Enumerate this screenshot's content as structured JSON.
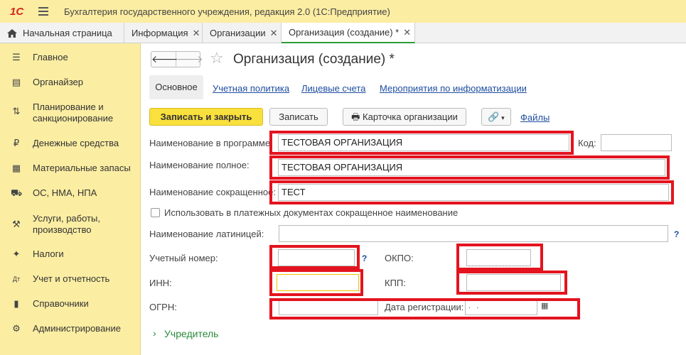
{
  "app": {
    "logo": "1С",
    "title": "Бухгалтерия государственного учреждения, редакция 2.0  (1С:Предприятие)"
  },
  "tabs": [
    {
      "label": "Начальная страница"
    },
    {
      "label": "Информация"
    },
    {
      "label": "Организации"
    },
    {
      "label": "Организация (создание) *"
    }
  ],
  "sidebar": {
    "items": [
      {
        "label": "Главное",
        "icon": "list-icon"
      },
      {
        "label": "Органайзер",
        "icon": "clipboard-icon"
      },
      {
        "label": "Планирование и",
        "label2": "санкционирование",
        "icon": "planning-icon"
      },
      {
        "label": "Денежные средства",
        "icon": "money-icon"
      },
      {
        "label": "Материальные запасы",
        "icon": "stock-icon"
      },
      {
        "label": "ОС, НМА, НПА",
        "icon": "truck-icon"
      },
      {
        "label": "Услуги, работы,",
        "label2": "производство",
        "icon": "tools-icon"
      },
      {
        "label": "Налоги",
        "icon": "emblem-icon"
      },
      {
        "label": "Учет и отчетность",
        "icon": "accounting-icon"
      },
      {
        "label": "Справочники",
        "icon": "book-icon"
      },
      {
        "label": "Администрирование",
        "icon": "gear-icon"
      }
    ]
  },
  "form": {
    "title": "Организация (создание) *",
    "subtabs": {
      "active": "Основное",
      "links": [
        "Учетная политика",
        "Лицевые счета",
        "Мероприятия по информатизации"
      ]
    },
    "toolbar": {
      "save_close": "Записать и закрыть",
      "save": "Записать",
      "card": "Карточка организации",
      "files": "Файлы"
    },
    "fields": {
      "name_program_label": "Наименование в программе:",
      "name_program_value": "ТЕСТОВАЯ ОРГАНИЗАЦИЯ",
      "code_label": "Код:",
      "code_value": "",
      "name_full_label": "Наименование полное:",
      "name_full_value": "ТЕСТОВАЯ ОРГАНИЗАЦИЯ",
      "name_short_label": "Наименование сокращенное:",
      "name_short_value": "ТЕСТ",
      "use_short_label": "Использовать в платежных документах сокращенное наименование",
      "name_latin_label": "Наименование латиницей:",
      "name_latin_value": "",
      "account_no_label": "Учетный номер:",
      "okpo_label": "ОКПО:",
      "inn_label": "ИНН:",
      "kpp_label": "КПП:",
      "ogrn_label": "ОГРН:",
      "reg_date_label": "Дата регистрации:",
      "reg_date_value": " .  ."
    },
    "help_mark": "?",
    "group_founder": "Учредитель"
  },
  "colors": {
    "sidebar_bg": "#fbeda2",
    "primary_button": "#fae03c",
    "highlight_box": "#e3141f",
    "link": "#1e4da0",
    "group": "#2a8a3a"
  }
}
